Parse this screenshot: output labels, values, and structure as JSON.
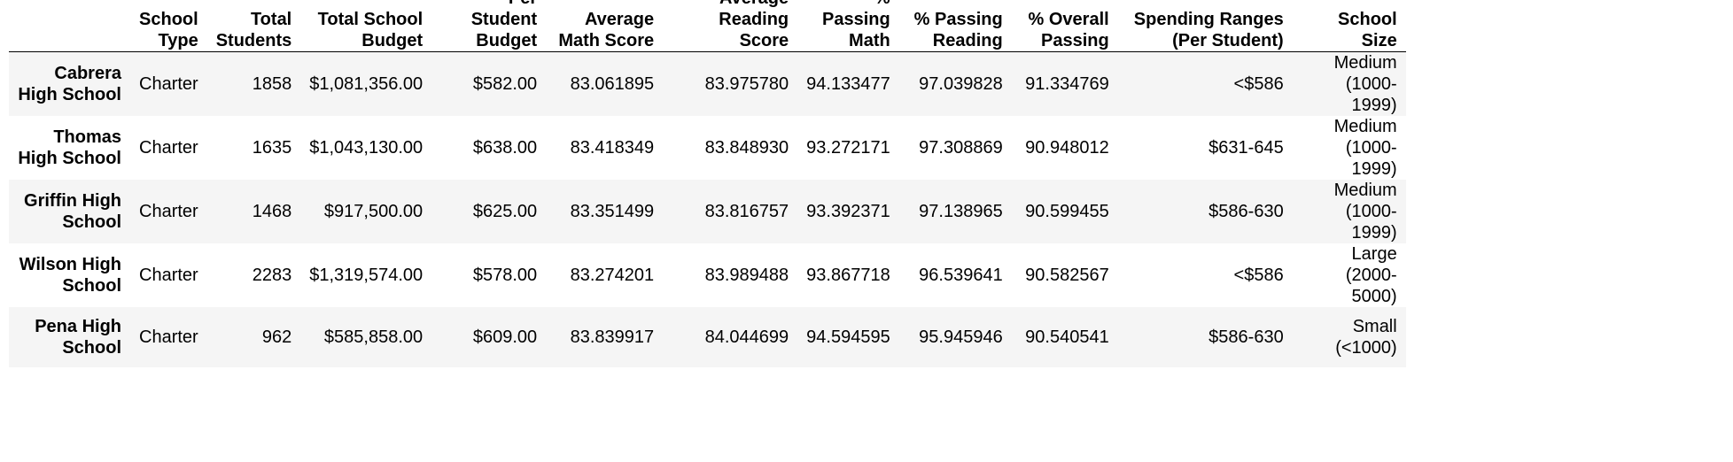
{
  "table": {
    "columns": [
      {
        "key": "name",
        "label": ""
      },
      {
        "key": "school_type",
        "label": "School Type"
      },
      {
        "key": "total_students",
        "label": "Total Students"
      },
      {
        "key": "total_budget",
        "label": "Total School Budget"
      },
      {
        "key": "per_student_budget",
        "label": "Per Student Budget"
      },
      {
        "key": "avg_math",
        "label": "Average Math Score"
      },
      {
        "key": "avg_reading",
        "label": "Average Reading Score"
      },
      {
        "key": "pct_math",
        "label": "% Passing Math"
      },
      {
        "key": "pct_reading",
        "label": "% Passing Reading"
      },
      {
        "key": "pct_overall",
        "label": "% Overall Passing"
      },
      {
        "key": "spending_range",
        "label": "Spending Ranges (Per Student)"
      },
      {
        "key": "school_size",
        "label": "School Size"
      }
    ],
    "rows": [
      {
        "name": "Cabrera High School",
        "school_type": "Charter",
        "total_students": "1858",
        "total_budget": "$1,081,356.00",
        "per_student_budget": "$582.00",
        "avg_math": "83.061895",
        "avg_reading": "83.975780",
        "pct_math": "94.133477",
        "pct_reading": "97.039828",
        "pct_overall": "91.334769",
        "spending_range": "<$586",
        "school_size": "Medium (1000-1999)"
      },
      {
        "name": "Thomas High School",
        "school_type": "Charter",
        "total_students": "1635",
        "total_budget": "$1,043,130.00",
        "per_student_budget": "$638.00",
        "avg_math": "83.418349",
        "avg_reading": "83.848930",
        "pct_math": "93.272171",
        "pct_reading": "97.308869",
        "pct_overall": "90.948012",
        "spending_range": "$631-645",
        "school_size": "Medium (1000-1999)"
      },
      {
        "name": "Griffin High School",
        "school_type": "Charter",
        "total_students": "1468",
        "total_budget": "$917,500.00",
        "per_student_budget": "$625.00",
        "avg_math": "83.351499",
        "avg_reading": "83.816757",
        "pct_math": "93.392371",
        "pct_reading": "97.138965",
        "pct_overall": "90.599455",
        "spending_range": "$586-630",
        "school_size": "Medium (1000-1999)"
      },
      {
        "name": "Wilson High School",
        "school_type": "Charter",
        "total_students": "2283",
        "total_budget": "$1,319,574.00",
        "per_student_budget": "$578.00",
        "avg_math": "83.274201",
        "avg_reading": "83.989488",
        "pct_math": "93.867718",
        "pct_reading": "96.539641",
        "pct_overall": "90.582567",
        "spending_range": "<$586",
        "school_size": "Large (2000-5000)"
      },
      {
        "name": "Pena High School",
        "school_type": "Charter",
        "total_students": "962",
        "total_budget": "$585,858.00",
        "per_student_budget": "$609.00",
        "avg_math": "83.839917",
        "avg_reading": "84.044699",
        "pct_math": "94.594595",
        "pct_reading": "95.945946",
        "pct_overall": "90.540541",
        "spending_range": "$586-630",
        "school_size": "Small (<1000)"
      }
    ]
  }
}
